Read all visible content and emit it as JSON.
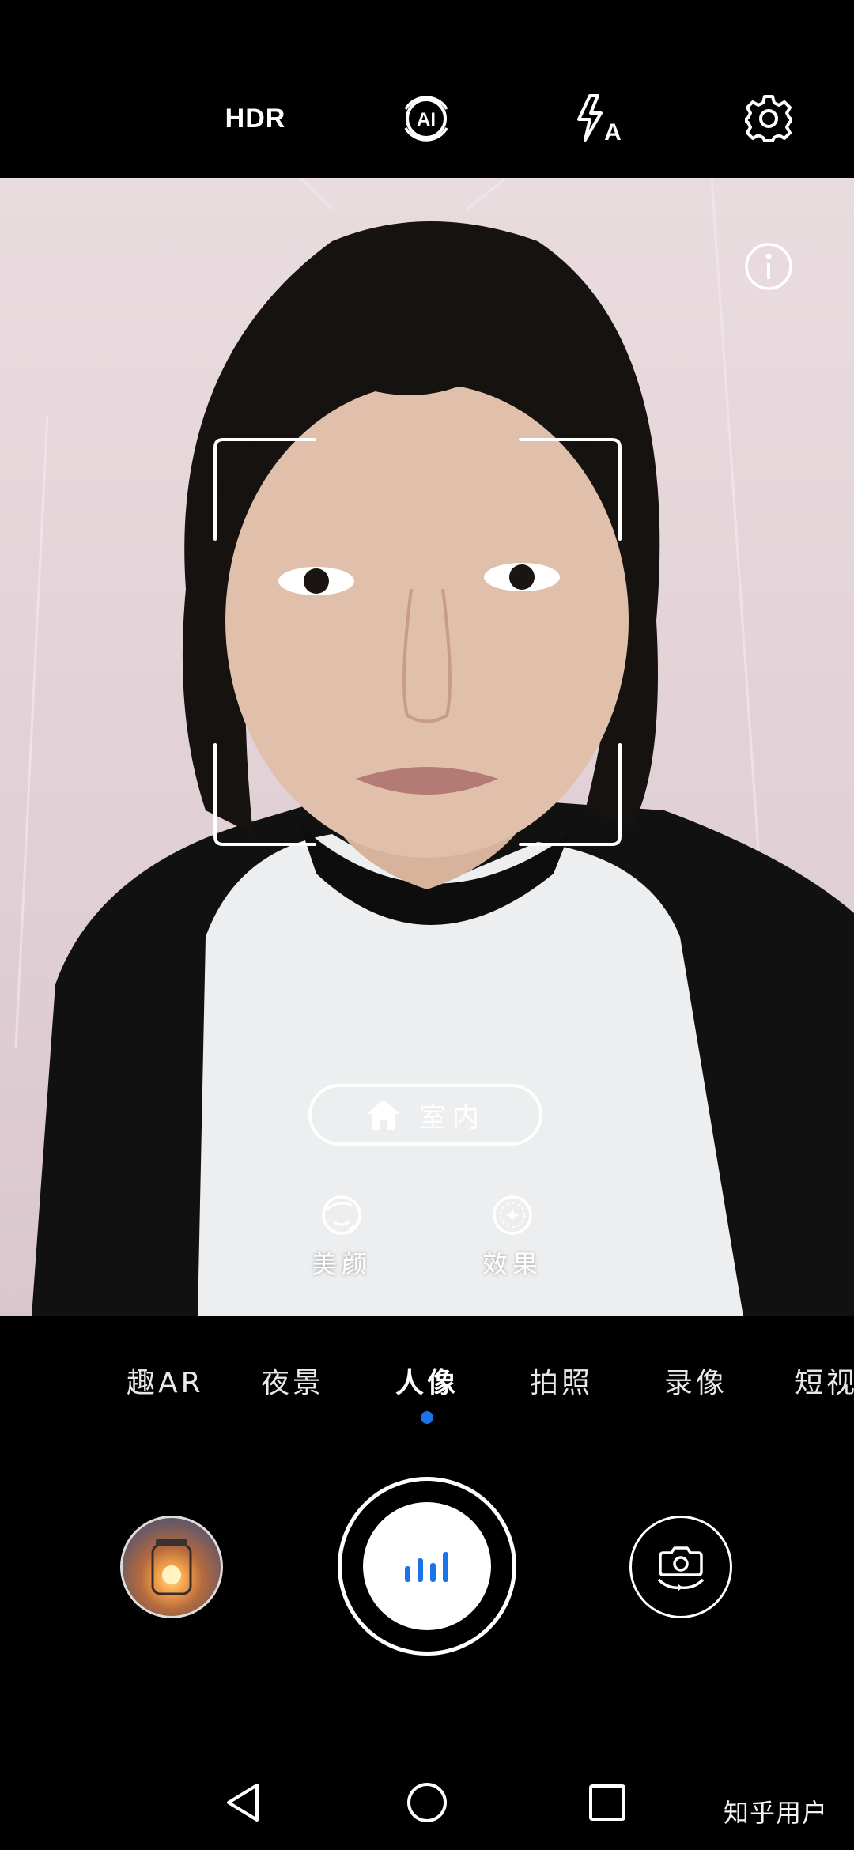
{
  "toolbar": {
    "hdr_label": "HDR",
    "ai_icon": "ai-scene-icon",
    "flash_icon": "flash-auto-icon",
    "settings_icon": "gear-icon"
  },
  "viewfinder": {
    "info_icon": "info-icon",
    "scene": {
      "icon": "home-icon",
      "label": "室内"
    },
    "tools": [
      {
        "label": "美颜",
        "icon": "beauty-face-icon"
      },
      {
        "label": "效果",
        "icon": "effect-icon"
      }
    ]
  },
  "modes": {
    "items": [
      "趣AR",
      "夜景",
      "人像",
      "拍照",
      "录像",
      "短视"
    ],
    "active": "人像"
  },
  "shutter": {
    "gallery_icon": "gallery-thumbnail",
    "shutter_icon": "bars-icon",
    "switch_icon": "switch-camera-icon"
  },
  "navbar": {
    "back_icon": "back-triangle-icon",
    "home_icon": "home-circle-icon",
    "recents_icon": "recents-square-icon"
  },
  "watermark": "知乎用户",
  "colors": {
    "accent": "#1a73e8",
    "background": "#000000"
  }
}
